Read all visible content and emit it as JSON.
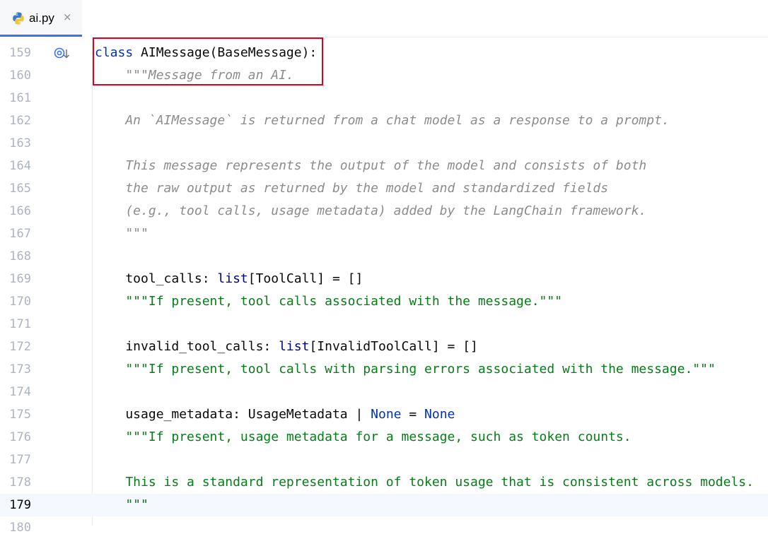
{
  "tab": {
    "file_name": "ai.py",
    "close_glyph": "×",
    "icon": "python-file-icon"
  },
  "gutter": {
    "icon": "implemented-down-icon"
  },
  "colors": {
    "keyword": "#0033b3",
    "docstring": "#8c8c8c",
    "string": "#067d17",
    "highlight_box": "#e0001a",
    "active_tab_underline": "#3574f0"
  },
  "current_line": 179,
  "lines": [
    {
      "n": "159",
      "tokens": [
        {
          "t": "class",
          "c": "kw"
        },
        {
          "t": " AIMessage(BaseMessage):",
          "c": "plain"
        }
      ]
    },
    {
      "n": "160",
      "tokens": [
        {
          "t": "    \"\"\"Message from an AI.",
          "c": "doc"
        }
      ]
    },
    {
      "n": "161",
      "tokens": []
    },
    {
      "n": "162",
      "tokens": [
        {
          "t": "    An `AIMessage` is returned from a chat model as a response to a prompt.",
          "c": "doc"
        }
      ]
    },
    {
      "n": "163",
      "tokens": []
    },
    {
      "n": "164",
      "tokens": [
        {
          "t": "    This message represents the output of the model and consists of both",
          "c": "doc"
        }
      ]
    },
    {
      "n": "165",
      "tokens": [
        {
          "t": "    the raw output as returned by the model and standardized fields",
          "c": "doc"
        }
      ]
    },
    {
      "n": "166",
      "tokens": [
        {
          "t": "    (e.g., tool calls, usage metadata) added by the LangChain framework.",
          "c": "doc"
        }
      ]
    },
    {
      "n": "167",
      "tokens": [
        {
          "t": "    \"\"\"",
          "c": "doc"
        }
      ]
    },
    {
      "n": "168",
      "tokens": []
    },
    {
      "n": "169",
      "tokens": [
        {
          "t": "    tool_calls: ",
          "c": "plain"
        },
        {
          "t": "list",
          "c": "builtin"
        },
        {
          "t": "[ToolCall] = []",
          "c": "plain"
        }
      ]
    },
    {
      "n": "170",
      "tokens": [
        {
          "t": "    \"\"\"If present, tool calls associated with the message.\"\"\"",
          "c": "str"
        }
      ]
    },
    {
      "n": "171",
      "tokens": []
    },
    {
      "n": "172",
      "tokens": [
        {
          "t": "    invalid_tool_calls: ",
          "c": "plain"
        },
        {
          "t": "list",
          "c": "builtin"
        },
        {
          "t": "[InvalidToolCall] = []",
          "c": "plain"
        }
      ]
    },
    {
      "n": "173",
      "tokens": [
        {
          "t": "    \"\"\"If present, tool calls with parsing errors associated with the message.\"\"\"",
          "c": "str"
        }
      ]
    },
    {
      "n": "174",
      "tokens": []
    },
    {
      "n": "175",
      "tokens": [
        {
          "t": "    usage_metadata: UsageMetadata | ",
          "c": "plain"
        },
        {
          "t": "None",
          "c": "kw"
        },
        {
          "t": " = ",
          "c": "plain"
        },
        {
          "t": "None",
          "c": "kw"
        }
      ]
    },
    {
      "n": "176",
      "tokens": [
        {
          "t": "    \"\"\"If present, usage metadata for a message, such as token counts.",
          "c": "str"
        }
      ]
    },
    {
      "n": "177",
      "tokens": []
    },
    {
      "n": "178",
      "tokens": [
        {
          "t": "    This is a standard representation of token usage that is consistent across models.",
          "c": "str"
        }
      ]
    },
    {
      "n": "179",
      "tokens": [
        {
          "t": "    \"\"\"",
          "c": "str"
        }
      ]
    },
    {
      "n": "180",
      "tokens": []
    }
  ]
}
